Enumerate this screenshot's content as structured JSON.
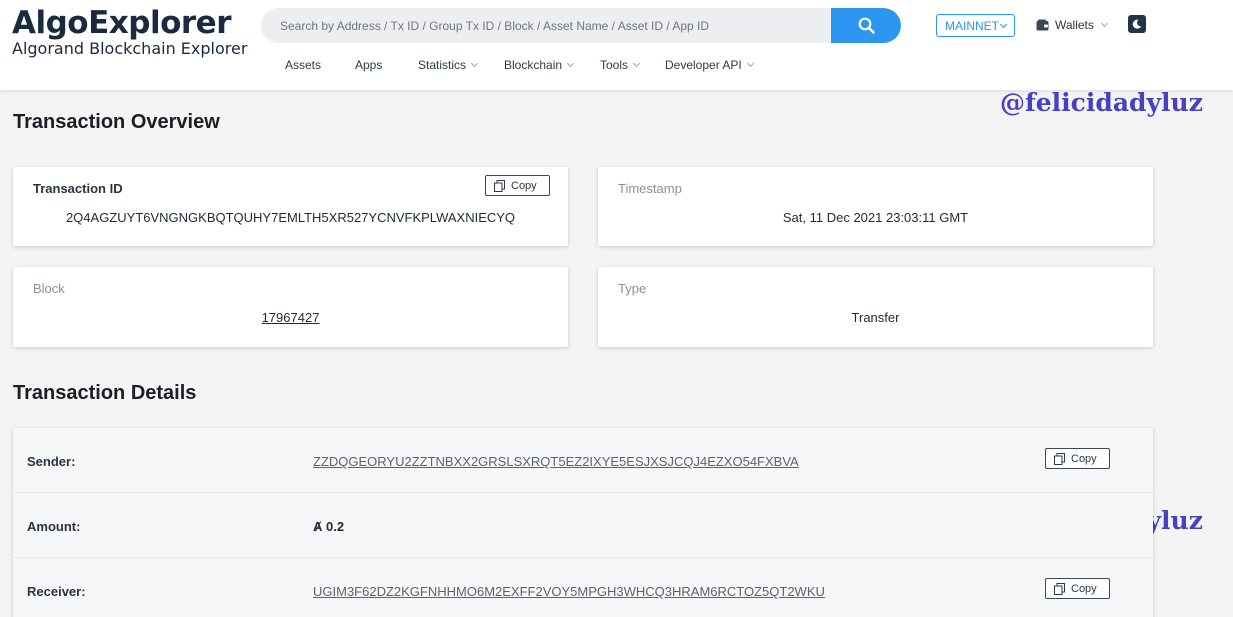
{
  "header": {
    "logo_title": "AlgoExplorer",
    "logo_subtitle": "Algorand Blockchain Explorer",
    "search_placeholder": "Search by Address / Tx ID / Group Tx ID / Block / Asset Name / Asset ID / App ID",
    "network": "MAINNET",
    "wallets": "Wallets"
  },
  "nav": {
    "items": [
      {
        "label": "Assets"
      },
      {
        "label": "Apps"
      },
      {
        "label": "Statistics"
      },
      {
        "label": "Blockchain"
      },
      {
        "label": "Tools"
      },
      {
        "label": "Developer API"
      }
    ]
  },
  "watermark": "@felicidadyluz",
  "overview": {
    "title": "Transaction Overview",
    "transaction_id": {
      "label": "Transaction ID",
      "value": "2Q4AGZUYT6VNGNGKBQTQUHY7EMLTH5XR527YCNVFKPLWAXNIECYQ"
    },
    "timestamp": {
      "label": "Timestamp",
      "value": "Sat, 11 Dec 2021 23:03:11 GMT"
    },
    "block": {
      "label": "Block",
      "value": "17967427"
    },
    "type": {
      "label": "Type",
      "value": "Transfer"
    },
    "copy_label": "Copy"
  },
  "details": {
    "title": "Transaction Details",
    "sender": {
      "label": "Sender:",
      "value": "ZZDQGEORYU2ZZTNBXX2GRSLSXRQT5EZ2IXYE5ESJXSJCQJ4EZXO54FXBVA"
    },
    "amount": {
      "label": "Amount:",
      "symbol": "Ⱥ",
      "value": "0.2"
    },
    "receiver": {
      "label": "Receiver:",
      "value": "UGIM3F62DZ2KGFNHHMO6M2EXFF2VOY5MPGH3WHCQ3HRAM6RCTOZ5QT2WKU"
    }
  },
  "colors": {
    "accent": "#2d96f0",
    "watermark": "#4a3fc4",
    "header_text": "#1a2a3f"
  },
  "icons": {
    "search": "search-icon",
    "wallet": "wallet-icon",
    "theme": "moon-icon",
    "copy": "copy-icon"
  }
}
